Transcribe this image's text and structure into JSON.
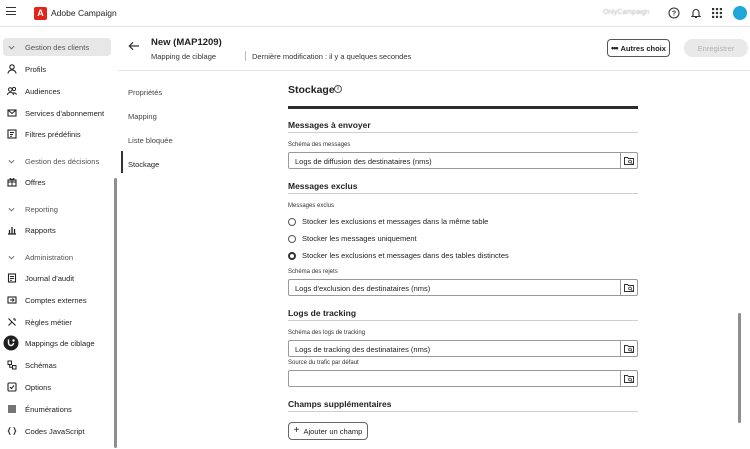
{
  "app": {
    "name": "Adobe Campaign",
    "org_name": "OnlyCampaign"
  },
  "sidebar": {
    "items": [
      {
        "label": "Gestion des clients",
        "type": "group"
      },
      {
        "label": "Profils",
        "icon": "profile-icon"
      },
      {
        "label": "Audiences",
        "icon": "audience-icon"
      },
      {
        "label": "Services d'abonnement",
        "icon": "subscription-icon"
      },
      {
        "label": "Filtres prédéfinis",
        "icon": "filter-icon"
      },
      {
        "label": "Gestion des décisions",
        "type": "group"
      },
      {
        "label": "Offres",
        "icon": "offer-icon"
      },
      {
        "label": "Reporting",
        "type": "group"
      },
      {
        "label": "Rapports",
        "icon": "report-icon"
      },
      {
        "label": "Administration",
        "type": "group"
      },
      {
        "label": "Journal d'audit",
        "icon": "audit-icon"
      },
      {
        "label": "Comptes externes",
        "icon": "external-accounts-icon"
      },
      {
        "label": "Règles métier",
        "icon": "rules-icon"
      },
      {
        "label": "Mappings de ciblage",
        "icon": "targeting-icon",
        "selected": true
      },
      {
        "label": "Schémas",
        "icon": "schema-icon"
      },
      {
        "label": "Options",
        "icon": "options-icon"
      },
      {
        "label": "Énumérations",
        "icon": "enumeration-icon"
      },
      {
        "label": "Codes JavaScript",
        "icon": "javascript-icon"
      }
    ]
  },
  "header": {
    "title": "New (MAP1209)",
    "type": "Mapping de ciblage",
    "modified": "Dernière modification : il y a quelques secondes",
    "more_label": "Autres choix",
    "save_label": "Enregistrer"
  },
  "tabs": [
    {
      "label": "Propriétés"
    },
    {
      "label": "Mapping"
    },
    {
      "label": "Liste bloquée"
    },
    {
      "label": "Stockage",
      "active": true
    }
  ],
  "form": {
    "title": "Stockage",
    "messages_to_send": {
      "heading": "Messages à envoyer",
      "schema_label": "Schéma des messages",
      "schema_value": "Logs de diffusion des destinataires (nms)"
    },
    "excluded": {
      "heading": "Messages exclus",
      "label": "Messages exclus",
      "options": [
        {
          "label": "Stocker les exclusions et messages dans la même table",
          "selected": false
        },
        {
          "label": "Stocker les messages uniquement",
          "selected": false
        },
        {
          "label": "Stocker les exclusions et messages dans des tables distinctes",
          "selected": true
        }
      ],
      "rejects_label": "Schéma des rejets",
      "rejects_value": "Logs d'exclusion des destinataires (nms)"
    },
    "tracking": {
      "heading": "Logs de tracking",
      "schema_label": "Schéma des logs de tracking",
      "schema_value": "Logs de tracking des destinataires (nms)",
      "source_label": "Source du trafic par défaut",
      "source_value": ""
    },
    "extra": {
      "heading": "Champs supplémentaires",
      "add_label": "Ajouter un champ"
    }
  }
}
